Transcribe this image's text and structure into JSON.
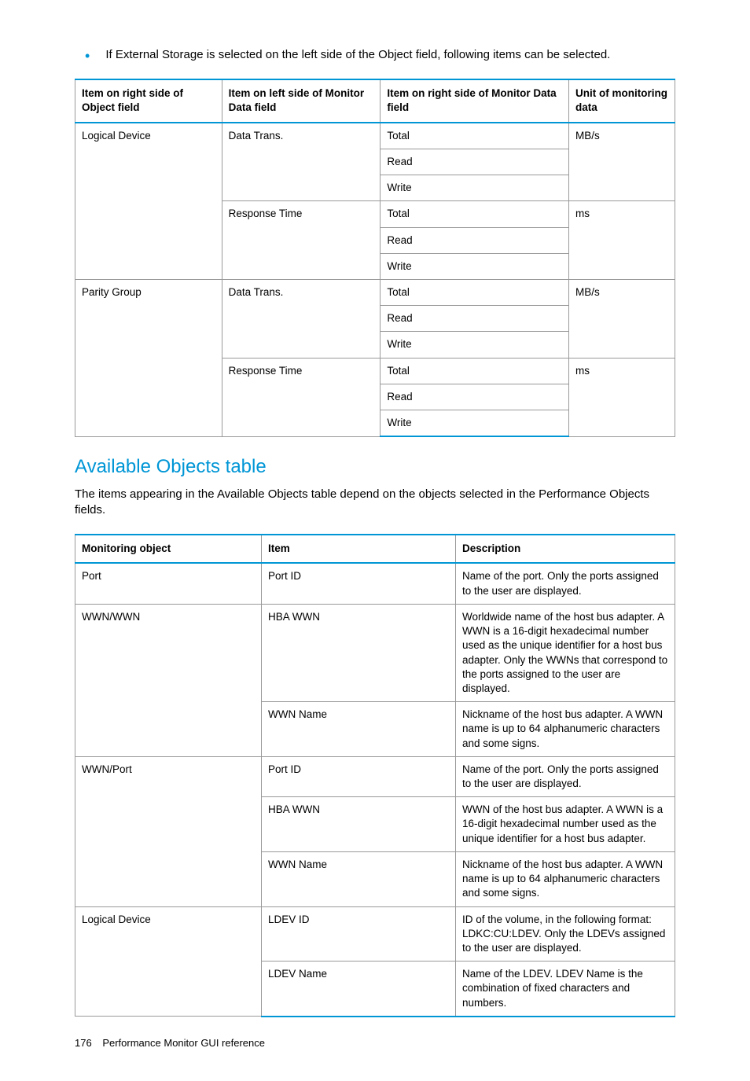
{
  "bullet": "If External Storage is selected on the left side of the Object field, following items can be selected.",
  "table1": {
    "headers": {
      "c1": "Item on right side of Object field",
      "c2": "Item on left side of Monitor Data field",
      "c3": "Item on right side of Monitor Data field",
      "c4": "Unit of monitoring data"
    },
    "groups": [
      {
        "object": "Logical Device",
        "subs": [
          {
            "left": "Data Trans.",
            "rights": [
              "Total",
              "Read",
              "Write"
            ],
            "unit": "MB/s"
          },
          {
            "left": "Response Time",
            "rights": [
              "Total",
              "Read",
              "Write"
            ],
            "unit": "ms"
          }
        ]
      },
      {
        "object": "Parity Group",
        "subs": [
          {
            "left": "Data Trans.",
            "rights": [
              "Total",
              "Read",
              "Write"
            ],
            "unit": "MB/s"
          },
          {
            "left": "Response Time",
            "rights": [
              "Total",
              "Read",
              "Write"
            ],
            "unit": "ms"
          }
        ]
      }
    ]
  },
  "section": {
    "title": "Available Objects table",
    "desc": "The items appearing in the Available Objects table depend on the objects selected in the Performance Objects fields."
  },
  "table2": {
    "headers": {
      "c1": "Monitoring object",
      "c2": "Item",
      "c3": "Description"
    },
    "rows": [
      {
        "obj": "Port",
        "items": [
          {
            "item": "Port ID",
            "desc": "Name of the port. Only the ports assigned to the user are displayed."
          }
        ]
      },
      {
        "obj": "WWN/WWN",
        "items": [
          {
            "item": "HBA WWN",
            "desc": "Worldwide name of the host bus adapter. A WWN is a 16-digit hexadecimal number used as the unique identifier for a host bus adapter. Only the WWNs that correspond to the ports assigned to the user are displayed."
          },
          {
            "item": "WWN Name",
            "desc": "Nickname of the host bus adapter. A WWN name is up to 64 alphanumeric characters and some signs."
          }
        ]
      },
      {
        "obj": "WWN/Port",
        "items": [
          {
            "item": "Port ID",
            "desc": "Name of the port. Only the ports assigned to the user are displayed."
          },
          {
            "item": "HBA WWN",
            "desc": "WWN of the host bus adapter. A WWN is a 16-digit hexadecimal number used as the unique identifier for a host bus adapter."
          },
          {
            "item": "WWN Name",
            "desc": "Nickname of the host bus adapter. A WWN name is up to 64 alphanumeric characters and some signs."
          }
        ]
      },
      {
        "obj": "Logical Device",
        "items": [
          {
            "item": "LDEV ID",
            "desc": "ID of the volume, in the following format: LDKC:CU:LDEV. Only the LDEVs assigned to the user are displayed."
          },
          {
            "item": "LDEV Name",
            "desc": "Name of the LDEV. LDEV Name is the combination of fixed characters and numbers."
          }
        ]
      }
    ]
  },
  "footer": {
    "page": "176",
    "title": "Performance Monitor GUI reference"
  }
}
